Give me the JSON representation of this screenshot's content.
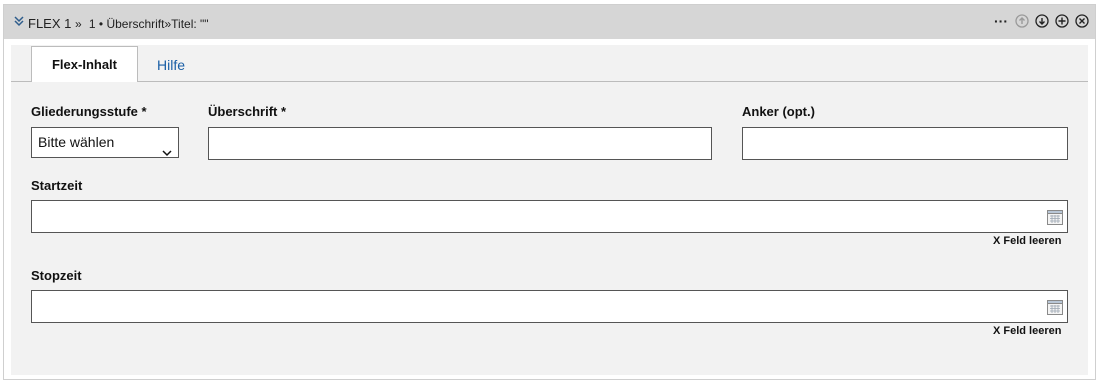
{
  "header": {
    "label": "FLEX 1",
    "separator": "»",
    "detail": "1 • Überschrift»Titel: \"\"",
    "more_label": "···",
    "icons": [
      "chevron-double-down-icon",
      "move-up-icon",
      "move-down-icon",
      "add-icon",
      "close-icon"
    ]
  },
  "tabs": [
    {
      "label": "Flex-Inhalt",
      "active": true
    },
    {
      "label": "Hilfe",
      "active": false
    }
  ],
  "form": {
    "level_label": "Gliederungsstufe *",
    "level_value": "Bitte wählen",
    "heading_label": "Überschrift *",
    "heading_value": "",
    "anchor_label": "Anker (opt.)",
    "anchor_value": "",
    "start_label": "Startzeit",
    "start_value": "",
    "start_clear": "X Feld leeren",
    "stop_label": "Stopzeit",
    "stop_value": "",
    "stop_clear": "X Feld leeren"
  },
  "colors": {
    "header_bg": "#d6d6d6",
    "body_bg": "#f2f2f2",
    "link": "#1a5fa6",
    "icon_blue": "#2f5d8c"
  }
}
